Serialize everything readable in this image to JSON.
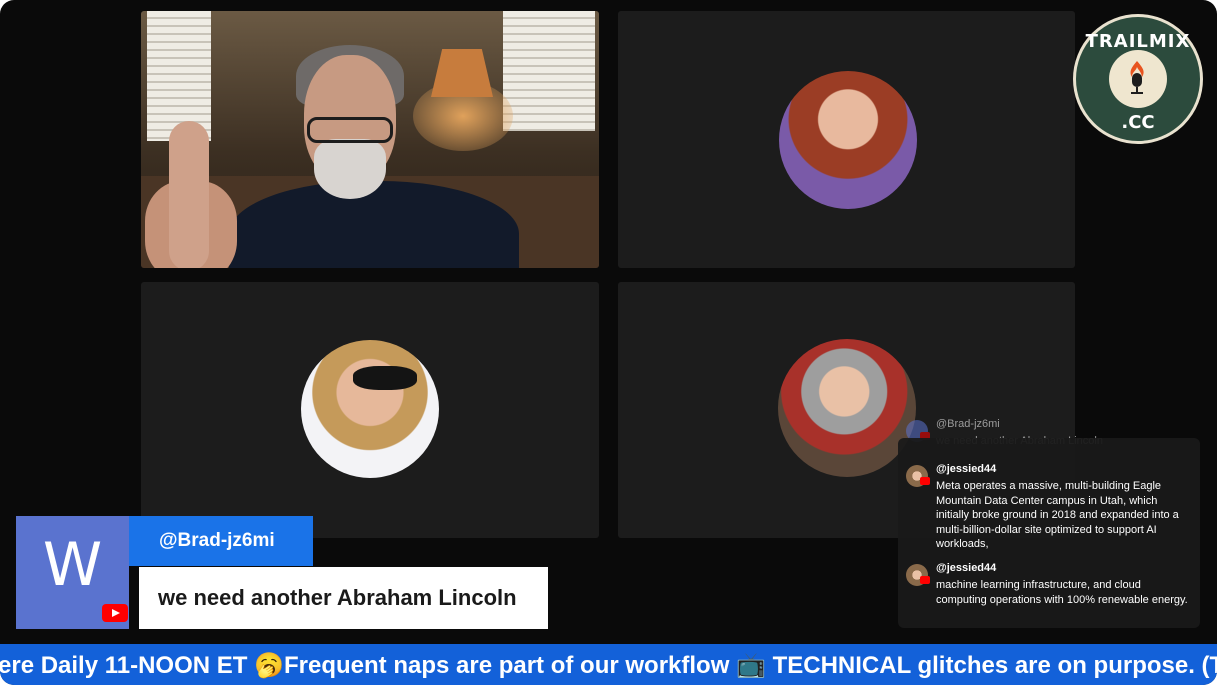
{
  "stream": {
    "logo": {
      "top_text": "TRAILMIX",
      "bottom_text": ".CC",
      "icon": "microphone-flame-icon"
    },
    "participants": [
      {
        "id": "p1",
        "type": "camera"
      },
      {
        "id": "p2",
        "type": "avatar"
      },
      {
        "id": "p3",
        "type": "avatar"
      },
      {
        "id": "p4",
        "type": "avatar"
      }
    ]
  },
  "lower_third": {
    "avatar_letter": "W",
    "username": "@Brad-jz6mi",
    "message": "we need another Abraham Lincoln",
    "platform_icon": "youtube-icon"
  },
  "chat": {
    "messages": [
      {
        "user": "@Brad-jz6mi",
        "text": "we need another Abraham Lincoln"
      },
      {
        "user": "@jessied44",
        "text": "Meta operates a massive, multi-building Eagle Mountain Data Center campus in Utah, which initially broke ground in 2018 and expanded into a multi-billion-dollar site optimized to support AI workloads,"
      },
      {
        "user": "@jessied44",
        "text": "machine learning infrastructure, and cloud computing operations with 100% renewable energy."
      }
    ]
  },
  "ticker": {
    "text": "ere Daily 11-NOON ET 🥱Frequent naps are part of our workflow 📺 TECHNICAL glitches are on purpose. (T"
  },
  "colors": {
    "stage_bg": "#0a0a0a",
    "tile_bg": "#1c1c1c",
    "ticker_bg": "#1361d9",
    "name_box_bg": "#1a73e8",
    "avatar_bg": "#5a73cf",
    "logo_green": "#2c4b3d",
    "youtube_red": "#ff0000"
  }
}
